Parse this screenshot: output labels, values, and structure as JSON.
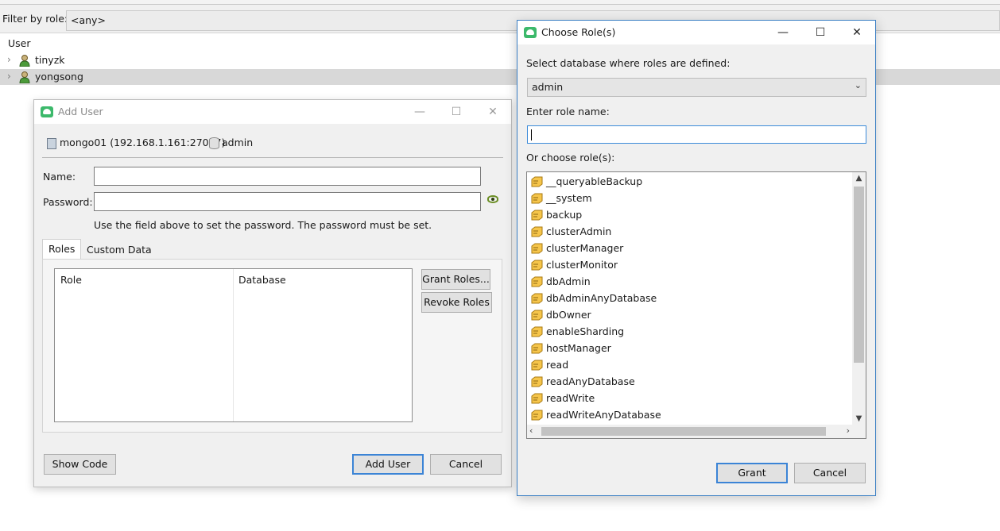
{
  "background": {
    "filter_label": "Filter by role:",
    "filter_value": "<any>",
    "tree_header": "User",
    "users": [
      {
        "name": "tinyzk",
        "selected": false
      },
      {
        "name": "yongsong",
        "selected": true
      }
    ]
  },
  "add_user": {
    "title": "Add User",
    "server": "mongo01 (192.168.1.161:27017)",
    "database": "admin",
    "name_label": "Name:",
    "name_value": "",
    "password_label": "Password:",
    "password_value": "",
    "password_hint": "Use the field above to set the password. The password must be set.",
    "tabs": [
      {
        "label": "Roles",
        "active": true
      },
      {
        "label": "Custom Data",
        "active": false
      }
    ],
    "roles_columns": [
      "Role",
      "Database"
    ],
    "grant_roles_label": "Grant Roles...",
    "revoke_roles_label": "Revoke Roles",
    "show_code_label": "Show Code",
    "add_user_label": "Add User",
    "cancel_label": "Cancel"
  },
  "choose_roles": {
    "title": "Choose Role(s)",
    "select_db_label": "Select database where roles are defined:",
    "selected_db": "admin",
    "role_name_label": "Enter role name:",
    "role_name_value": "",
    "choose_label": "Or choose role(s):",
    "roles": [
      "__queryableBackup",
      "__system",
      "backup",
      "clusterAdmin",
      "clusterManager",
      "clusterMonitor",
      "dbAdmin",
      "dbAdminAnyDatabase",
      "dbOwner",
      "enableSharding",
      "hostManager",
      "read",
      "readAnyDatabase",
      "readWrite",
      "readWriteAnyDatabase"
    ],
    "grant_label": "Grant",
    "cancel_label": "Cancel"
  },
  "icons": {
    "window_minimize": "—",
    "window_maximize": "☐",
    "window_close": "✕",
    "tree_expand": "›",
    "scroll_up": "▲",
    "scroll_down": "▼",
    "scroll_left": "‹",
    "scroll_right": "›",
    "dropdown": "⌄"
  },
  "colors": {
    "accent": "#3b84d6",
    "app_icon": "#3cb96b",
    "role_icon": "#f0b429"
  }
}
